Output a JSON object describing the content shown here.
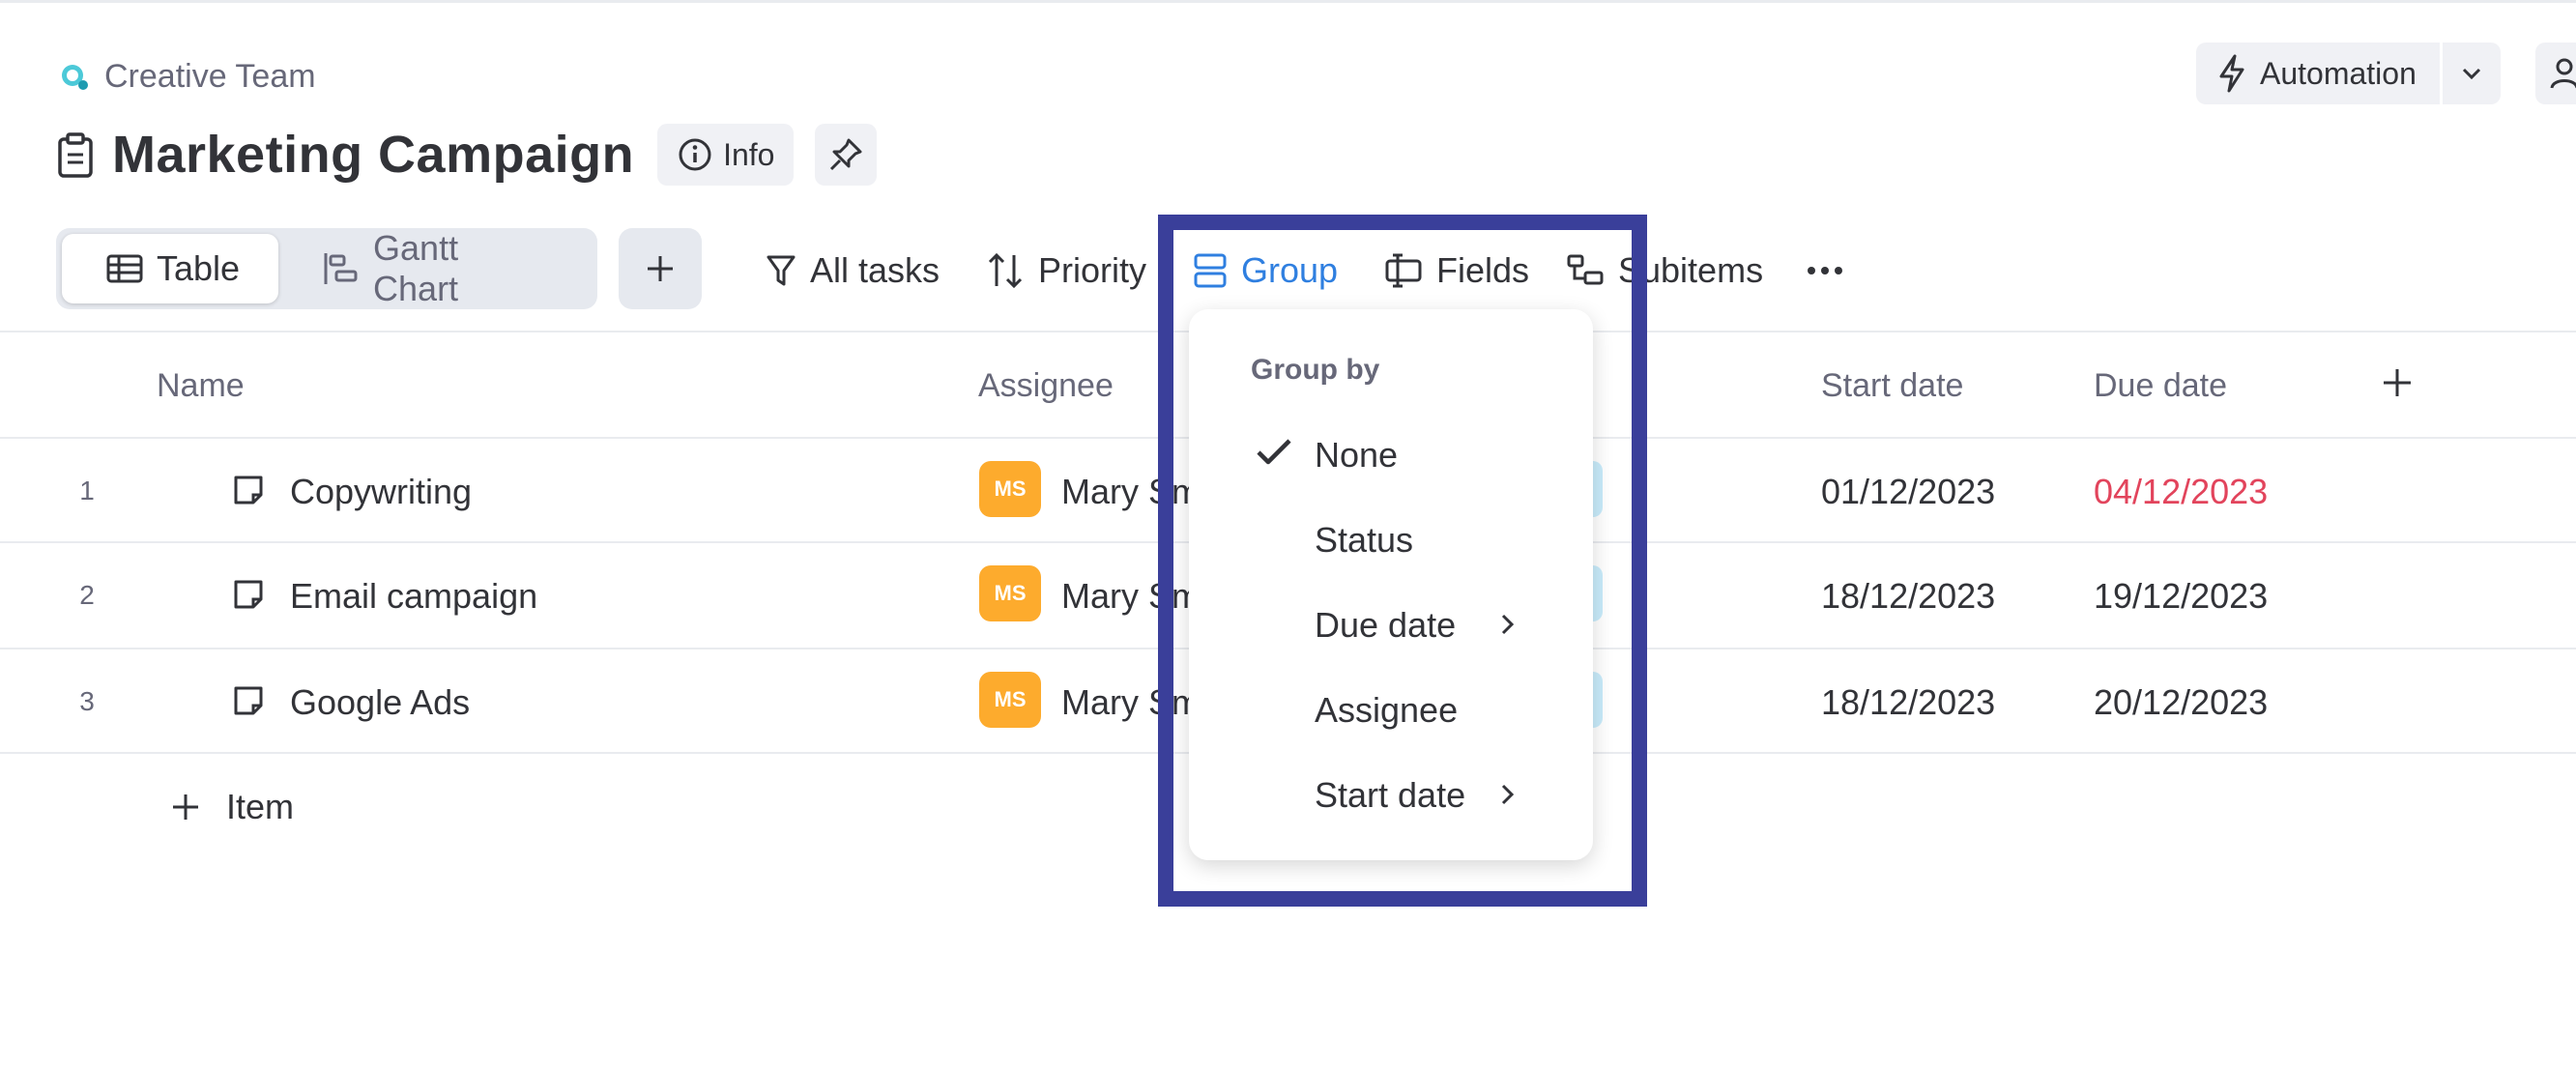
{
  "workspace": {
    "name": "Creative Team"
  },
  "board": {
    "title": "Marketing Campaign",
    "info_label": "Info"
  },
  "header_actions": {
    "automation_label": "Automation"
  },
  "views": [
    {
      "label": "Table",
      "active": true
    },
    {
      "label": "Gantt Chart",
      "active": false
    }
  ],
  "toolbar": {
    "all_tasks": "All tasks",
    "priority": "Priority",
    "group": "Group",
    "fields": "Fields",
    "subitems": "Subitems"
  },
  "columns": {
    "name": "Name",
    "assignee": "Assignee",
    "start_date": "Start date",
    "due_date": "Due date"
  },
  "rows": [
    {
      "num": "1",
      "name": "Copywriting",
      "assignee_initials": "MS",
      "assignee_name": "Mary Sm",
      "start": "01/12/2023",
      "due": "04/12/2023",
      "overdue": true
    },
    {
      "num": "2",
      "name": "Email campaign",
      "assignee_initials": "MS",
      "assignee_name": "Mary Sm",
      "start": "18/12/2023",
      "due": "19/12/2023",
      "overdue": false
    },
    {
      "num": "3",
      "name": "Google Ads",
      "assignee_initials": "MS",
      "assignee_name": "Mary Sm",
      "start": "18/12/2023",
      "due": "20/12/2023",
      "overdue": false
    }
  ],
  "add_item_label": "Item",
  "group_menu": {
    "title": "Group by",
    "options": [
      {
        "label": "None",
        "selected": true,
        "submenu": false
      },
      {
        "label": "Status",
        "selected": false,
        "submenu": false
      },
      {
        "label": "Due date",
        "selected": false,
        "submenu": true
      },
      {
        "label": "Assignee",
        "selected": false,
        "submenu": false
      },
      {
        "label": "Start date",
        "selected": false,
        "submenu": true
      }
    ]
  },
  "colors": {
    "accent": "#2f7fe0",
    "overdue": "#e2445c",
    "avatar": "#fdab2d",
    "highlight": "#3a3f9a",
    "status_pill": "#c9ecfb"
  }
}
